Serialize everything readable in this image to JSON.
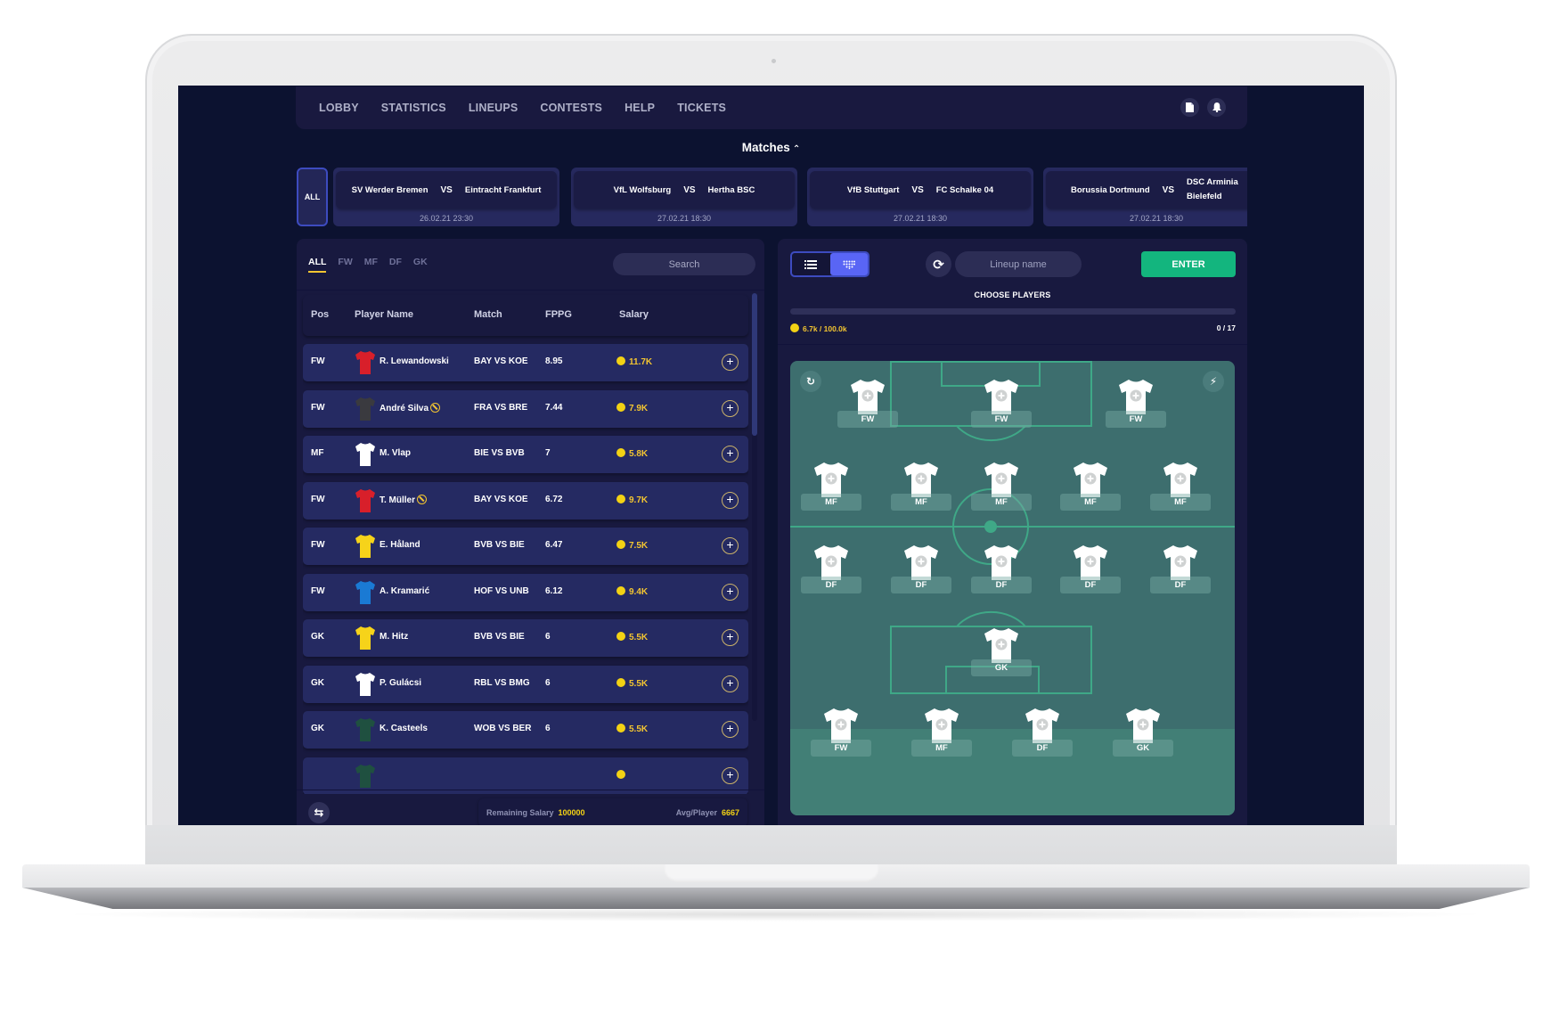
{
  "nav": {
    "items": [
      "LOBBY",
      "STATISTICS",
      "LINEUPS",
      "CONTESTS",
      "HELP",
      "TICKETS"
    ],
    "icons": [
      "document-icon",
      "bell-icon"
    ]
  },
  "matches": {
    "title": "Matches",
    "all_label": "ALL",
    "cards": [
      {
        "home": "SV Werder Bremen",
        "vs": "VS",
        "away": "Eintracht Frankfurt",
        "date": "26.02.21 23:30"
      },
      {
        "home": "VfL Wolfsburg",
        "vs": "VS",
        "away": "Hertha BSC",
        "date": "27.02.21 18:30"
      },
      {
        "home": "VfB Stuttgart",
        "vs": "VS",
        "away": "FC Schalke 04",
        "date": "27.02.21 18:30"
      },
      {
        "home": "Borussia Dortmund",
        "vs": "VS",
        "away": "DSC Arminia Bielefeld",
        "date": "27.02.21 18:30"
      }
    ]
  },
  "players_panel": {
    "tabs": [
      "ALL",
      "FW",
      "MF",
      "DF",
      "GK"
    ],
    "active_tab": "ALL",
    "search_placeholder": "Search",
    "columns": [
      "Pos",
      "Player Name",
      "Match",
      "FPPG",
      "Salary"
    ],
    "rows": [
      {
        "pos": "FW",
        "name": "R. Lewandowski",
        "flag": false,
        "match": "BAY VS KOE",
        "fppg": "8.95",
        "salary": "11.7K",
        "jersey": "#d81f2a"
      },
      {
        "pos": "FW",
        "name": "André Silva",
        "flag": true,
        "match": "FRA VS BRE",
        "fppg": "7.44",
        "salary": "7.9K",
        "jersey": "#3a3a3f"
      },
      {
        "pos": "MF",
        "name": "M. Vlap",
        "flag": false,
        "match": "BIE VS BVB",
        "fppg": "7",
        "salary": "5.8K",
        "jersey": "#ffffff"
      },
      {
        "pos": "FW",
        "name": "T. Müller",
        "flag": true,
        "match": "BAY VS KOE",
        "fppg": "6.72",
        "salary": "9.7K",
        "jersey": "#d81f2a"
      },
      {
        "pos": "FW",
        "name": "E. Håland",
        "flag": false,
        "match": "BVB VS BIE",
        "fppg": "6.47",
        "salary": "7.5K",
        "jersey": "#f6d31a"
      },
      {
        "pos": "FW",
        "name": "A. Kramarić",
        "flag": false,
        "match": "HOF VS UNB",
        "fppg": "6.12",
        "salary": "9.4K",
        "jersey": "#1a7ad4"
      },
      {
        "pos": "GK",
        "name": "M. Hitz",
        "flag": false,
        "match": "BVB VS BIE",
        "fppg": "6",
        "salary": "5.5K",
        "jersey": "#f6d31a"
      },
      {
        "pos": "GK",
        "name": "P. Gulácsi",
        "flag": false,
        "match": "RBL VS BMG",
        "fppg": "6",
        "salary": "5.5K",
        "jersey": "#ffffff"
      },
      {
        "pos": "GK",
        "name": "K. Casteels",
        "flag": false,
        "match": "WOB VS BER",
        "fppg": "6",
        "salary": "5.5K",
        "jersey": "#1f5040"
      },
      {
        "pos": "",
        "name": "",
        "flag": false,
        "match": "",
        "fppg": "",
        "salary": "",
        "jersey": "#1f5040"
      }
    ],
    "footer": {
      "remaining_label": "Remaining Salary",
      "remaining_value": "100000",
      "avg_label": "Avg/Player",
      "avg_value": "6667"
    }
  },
  "lineup_panel": {
    "lineup_name_placeholder": "Lineup name",
    "enter_label": "ENTER",
    "choose_label": "CHOOSE PLAYERS",
    "budget_text": "6.7k / 100.0k",
    "budget_progress_fraction": 0.0,
    "count_text": "0 / 17",
    "pitch_rows": [
      [
        "FW",
        "FW",
        "FW"
      ],
      [
        "MF",
        "MF",
        "MF",
        "MF",
        "MF"
      ],
      [
        "DF",
        "DF",
        "DF",
        "DF",
        "DF"
      ],
      [
        "GK"
      ]
    ],
    "bench": [
      "FW",
      "MF",
      "DF",
      "GK"
    ]
  }
}
